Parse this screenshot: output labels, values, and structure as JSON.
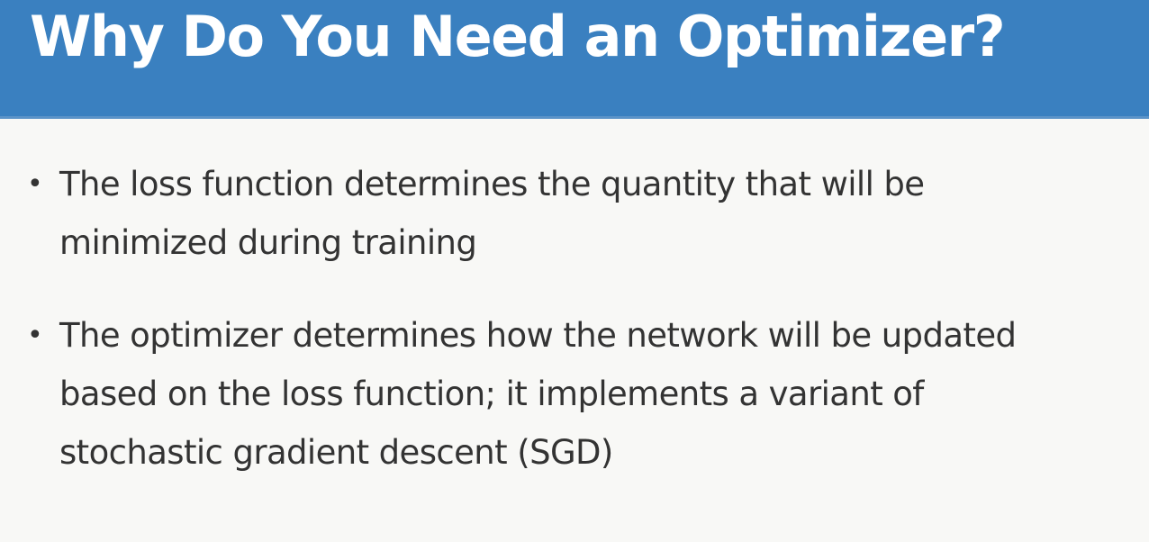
{
  "slide": {
    "title": "Why Do You Need an Optimizer?",
    "bullets": [
      {
        "lines": [
          "The loss function determines the quantity that will be",
          "minimized during training"
        ]
      },
      {
        "lines": [
          "The optimizer determines how the network will be updated",
          "based on the loss function; it implements a variant of",
          "stochastic gradient descent (SGD)"
        ]
      }
    ]
  },
  "colors": {
    "header_background": "#3a80c0",
    "title_text": "#ffffff",
    "body_text": "#333333",
    "slide_background": "#f8f8f6"
  }
}
